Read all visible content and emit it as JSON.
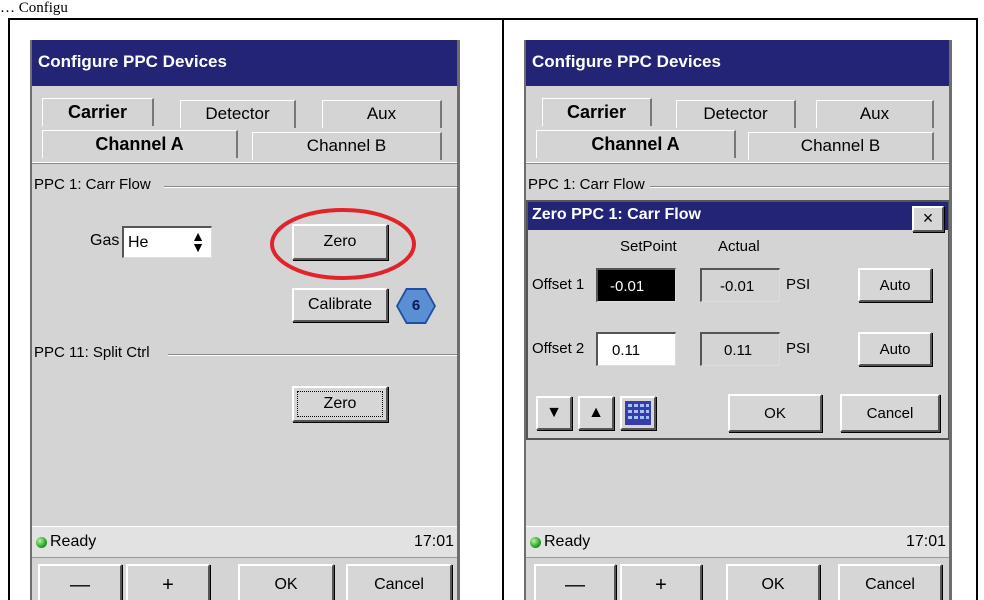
{
  "caption": "… Configu",
  "left": {
    "title": "Configure PPC Devices",
    "tabs": [
      "Carrier",
      "Detector",
      "Aux"
    ],
    "subtabs": [
      "Channel A",
      "Channel B"
    ],
    "section1": "PPC 1: Carr Flow",
    "gas_label": "Gas",
    "gas_value": "He",
    "zero_label": "Zero",
    "calibrate_label": "Calibrate",
    "badge": "6",
    "section2": "PPC 11: Split Ctrl",
    "zero2_label": "Zero",
    "status": "Ready",
    "time": "17:01",
    "minus": "—",
    "plus": "+",
    "ok": "OK",
    "cancel": "Cancel"
  },
  "right": {
    "title": "Configure PPC Devices",
    "tabs": [
      "Carrier",
      "Detector",
      "Aux"
    ],
    "subtabs": [
      "Channel A",
      "Channel B"
    ],
    "section1": "PPC 1: Carr Flow",
    "dialog": {
      "title": "Zero PPC 1: Carr Flow",
      "close": "×",
      "col_setpoint": "SetPoint",
      "col_actual": "Actual",
      "rows": [
        {
          "label": "Offset 1",
          "setpoint": "-0.01",
          "actual": "-0.01",
          "unit": "PSI",
          "auto": "Auto"
        },
        {
          "label": "Offset 2",
          "setpoint": "0.11",
          "actual": "0.11",
          "unit": "PSI",
          "auto": "Auto"
        }
      ],
      "down": "▼",
      "up": "▲",
      "ok": "OK",
      "cancel": "Cancel"
    },
    "status": "Ready",
    "time": "17:01",
    "minus": "—",
    "plus": "+",
    "ok": "OK",
    "cancel": "Cancel"
  },
  "colors": {
    "titlebar": "#232475",
    "highlight_circle": "#e0242a",
    "badge": "#4a7fcc",
    "status_dot": "#2aa02a"
  }
}
